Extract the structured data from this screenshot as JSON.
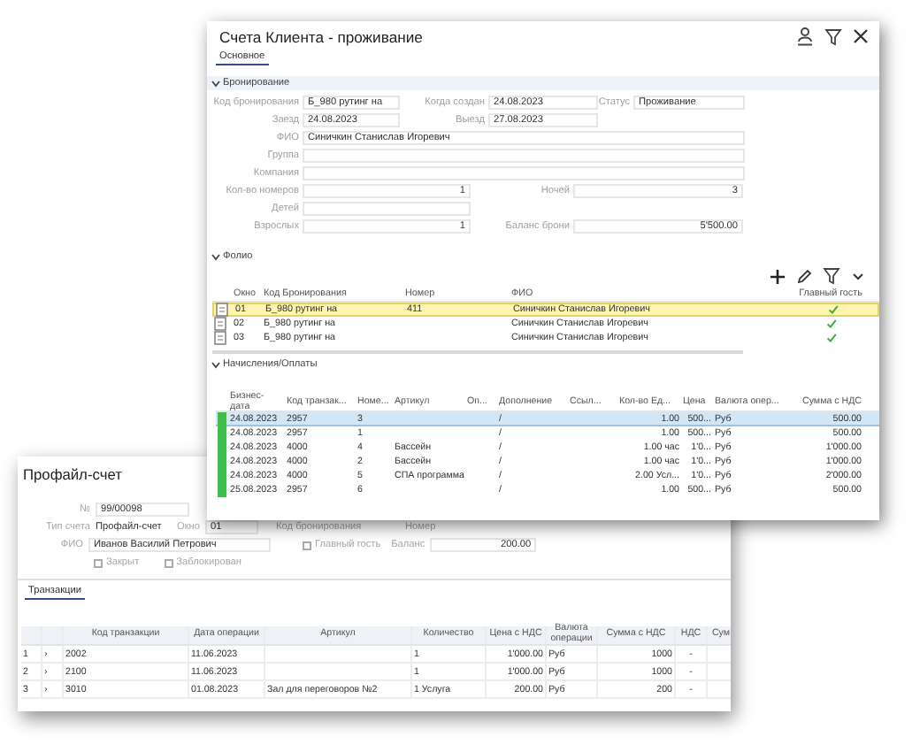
{
  "booking_window": {
    "title": "Счета Клиента - проживание",
    "tabs": [
      {
        "label": "Основное",
        "selected": true
      }
    ],
    "booking_section": {
      "title": "Бронирование",
      "expanded": true,
      "rows": [
        {
          "kind": "triple",
          "fields": [
            {
              "label": "Код бронирования",
              "value": "Б_980 рутинг на"
            },
            {
              "label": "Когда создан",
              "value": "24.08.2023"
            },
            {
              "label": "Статус",
              "value": "Проживание"
            }
          ]
        },
        {
          "kind": "triple",
          "fields": [
            {
              "label": "Заезд",
              "value": "24.08.2023"
            },
            {
              "label": "Выезд",
              "value": "27.08.2023"
            }
          ]
        },
        {
          "kind": "single",
          "fields": [
            {
              "label": "ФИО",
              "value": "Синичкин Станислав Игоревич"
            }
          ]
        },
        {
          "kind": "single",
          "fields": [
            {
              "label": "Группа"
            }
          ]
        },
        {
          "kind": "single",
          "fields": [
            {
              "label": "Компания"
            }
          ]
        },
        {
          "kind": "double",
          "fields": [
            {
              "label": "Кол-во номеров",
              "value": "1"
            },
            {
              "label": "Ночей",
              "value": "3"
            }
          ]
        },
        {
          "kind": "double",
          "fields": [
            {
              "label": "Детей"
            }
          ]
        },
        {
          "kind": "double",
          "fields": [
            {
              "label": "Взрослых",
              "value": "1"
            },
            {
              "label": "Баланс брони",
              "value": "5'500.00"
            }
          ]
        }
      ]
    },
    "folio_section": {
      "title": "Фолио",
      "expanded": true,
      "columns": [
        {
          "title": "Окно"
        },
        {
          "title": "Код Бронирования"
        },
        {
          "title": "Номер"
        },
        {
          "title": "ФИО"
        },
        {
          "title": "Главный гость"
        }
      ],
      "rows": [
        {
          "window": "01",
          "booking_code": "Б_980 рутинг на",
          "room": "411",
          "guest_name": "Синичкин Станислав Игоревич",
          "main_guest": true,
          "selected": true
        },
        {
          "window": "02",
          "booking_code": "Б_980 рутинг на",
          "guest_name": "Синичкин Станислав Игоревич",
          "main_guest": true,
          "selected": false
        },
        {
          "window": "03",
          "booking_code": "Б_980 рутинг на",
          "guest_name": "Синичкин Станислав Игоревич",
          "main_guest": true,
          "selected": false
        }
      ]
    },
    "charges_section": {
      "title": "Начисления/Оплаты",
      "expanded": true,
      "columns": [
        {
          "title": "Бизнес-дата"
        },
        {
          "title": "Код транзак..."
        },
        {
          "title": "Номе..."
        },
        {
          "title": "Артикул"
        },
        {
          "title": "Оп..."
        },
        {
          "title": "Дополнение"
        },
        {
          "title": "Ссыл..."
        },
        {
          "title": "Кол-во Ед..."
        },
        {
          "title": "Цена"
        },
        {
          "title": "Валюта опер..."
        },
        {
          "title": "Сумма с НДС"
        }
      ],
      "rows": [
        {
          "business_date": "24.08.2023",
          "transaction_code": "2957",
          "number": "3",
          "addition": "/",
          "quantity": "1.00",
          "price": "500...",
          "currency": "Руб",
          "sum_vat": "500.00",
          "selected": true
        },
        {
          "business_date": "24.08.2023",
          "transaction_code": "2957",
          "number": "1",
          "addition": "/",
          "quantity": "1.00",
          "price": "500...",
          "currency": "Руб",
          "sum_vat": "500.00",
          "selected": false
        },
        {
          "business_date": "24.08.2023",
          "transaction_code": "4000",
          "number": "4",
          "article": "Бассейн",
          "addition": "/",
          "quantity": "1.00 час",
          "price": "1'0...",
          "currency": "Руб",
          "sum_vat": "1'000.00",
          "selected": false
        },
        {
          "business_date": "24.08.2023",
          "transaction_code": "4000",
          "number": "2",
          "article": "Бассейн",
          "addition": "/",
          "quantity": "1.00 час",
          "price": "1'0...",
          "currency": "Руб",
          "sum_vat": "1'000.00",
          "selected": false
        },
        {
          "business_date": "24.08.2023",
          "transaction_code": "4000",
          "number": "5",
          "article": "СПА программа",
          "addition": "/",
          "quantity": "2.00 Усл...",
          "price": "1'0...",
          "currency": "Руб",
          "sum_vat": "2'000.00",
          "selected": false
        },
        {
          "business_date": "25.08.2023",
          "transaction_code": "2957",
          "number": "6",
          "addition": "/",
          "quantity": "1.00",
          "price": "500...",
          "currency": "Руб",
          "sum_vat": "500.00",
          "selected": false
        }
      ]
    }
  },
  "profile_window": {
    "title": "Профайл-счет",
    "form_rows": [
      {
        "items": [
          {
            "kind": "field",
            "label": "№",
            "value": "99/00098"
          }
        ]
      },
      {
        "items": [
          {
            "kind": "text",
            "label": "Тип счета",
            "value": "Профайл-счет"
          },
          {
            "kind": "field",
            "label": "Окно",
            "value": "01"
          },
          {
            "kind": "label",
            "label": "Код бронирования"
          },
          {
            "kind": "label",
            "label": "Номер"
          }
        ]
      },
      {
        "items": [
          {
            "kind": "field",
            "label": "ФИО",
            "value": "Иванов Василий Петрович"
          },
          {
            "kind": "checkbox",
            "label": "Главный гость",
            "checked": false
          },
          {
            "kind": "field",
            "label": "Баланс",
            "value": "200.00"
          }
        ]
      },
      {
        "items": [
          {
            "kind": "checkbox",
            "label": "Закрыт",
            "checked": false
          },
          {
            "kind": "checkbox",
            "label": "Заблокирован",
            "checked": false
          }
        ]
      }
    ],
    "tabs": [
      {
        "label": "Транзакции",
        "selected": true
      }
    ],
    "transactions": {
      "columns": [
        {
          "title": "Код транзакции"
        },
        {
          "title": "Дата операции"
        },
        {
          "title": "Артикул"
        },
        {
          "title": "Количество"
        },
        {
          "title": "Цена с НДС"
        },
        {
          "title": "Валюта операции"
        },
        {
          "title": "Сумма с НДС"
        },
        {
          "title": "НДС"
        },
        {
          "title": "Сум"
        }
      ],
      "rows": [
        {
          "number": "1",
          "expander": "›",
          "transaction_code": "2002",
          "operation_date": "11.06.2023",
          "quantity": "1",
          "price_vat": "1'000.00",
          "currency": "Руб",
          "sum_vat": "1000",
          "vat": "-"
        },
        {
          "number": "2",
          "expander": "›",
          "transaction_code": "2100",
          "operation_date": "11.06.2023",
          "quantity": "1",
          "price_vat": "1'000.00",
          "currency": "Руб",
          "sum_vat": "1000",
          "vat": "-"
        },
        {
          "number": "3",
          "expander": "›",
          "transaction_code": "3010",
          "operation_date": "01.08.2023",
          "article": "Зал для переговоров №2",
          "quantity": "1 Услуга",
          "price_vat": "200.00",
          "currency": "Руб",
          "sum_vat": "200",
          "vat": "-"
        }
      ]
    }
  }
}
